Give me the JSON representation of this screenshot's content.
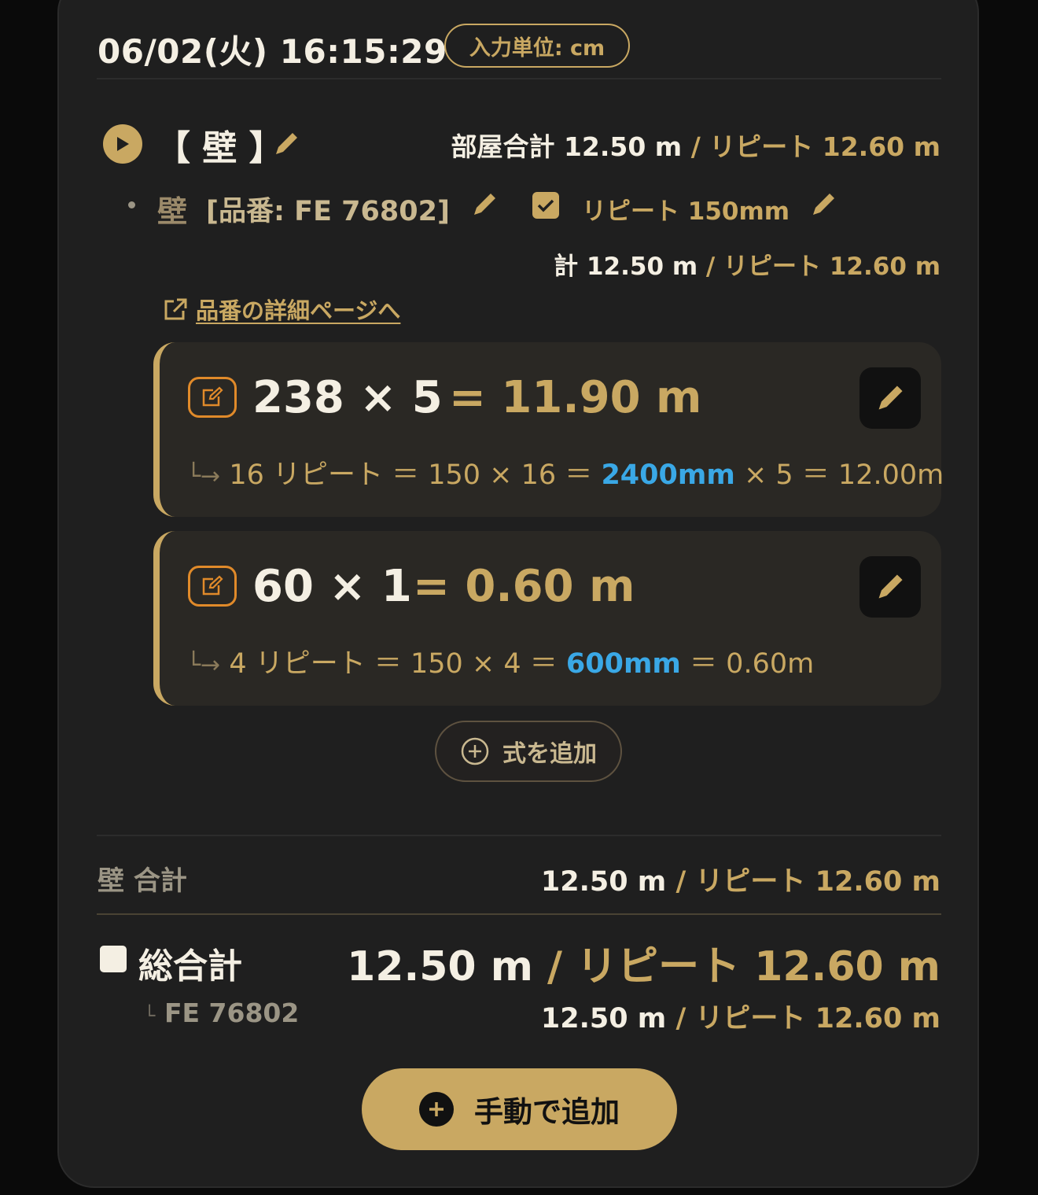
{
  "header": {
    "datetime": "06/02(火) 16:15:29",
    "unit_badge": "入力単位: cm"
  },
  "room": {
    "title": "【 壁 】",
    "total_label": "部屋合計",
    "total_value": "12.50 m",
    "separator": " / ",
    "repeat_label": "リピート",
    "repeat_value": "12.60 m"
  },
  "item": {
    "name": "壁",
    "code": "[品番: FE 76802]",
    "repeat_checked": true,
    "repeat_text": "リピート 150mm",
    "total_label": "計",
    "total_value": "12.50 m",
    "separator": " / ",
    "repeat_label": "リピート",
    "repeat_value": "12.60 m",
    "detail_link": "品番の詳細ページへ"
  },
  "formulas": [
    {
      "expression": "238 × 5",
      "result": "= 11.90 m",
      "detail_prefix": "16 リピート ＝ 150 × 16 ＝",
      "detail_highlight": "2400mm",
      "detail_suffix": "× 5 ＝ 12.00m"
    },
    {
      "expression": "60 × 1",
      "result": "= 0.60 m",
      "detail_prefix": "4 リピート ＝ 150 × 4 ＝",
      "detail_highlight": "600mm",
      "detail_suffix": "＝ 0.60m"
    }
  ],
  "add_formula_label": "式を追加",
  "wall_total": {
    "label": "壁 合計",
    "value": "12.50 m",
    "separator": " / ",
    "repeat_label": "リピート",
    "repeat_value": "12.60 m"
  },
  "grand_total": {
    "label": "総合計",
    "value": "12.50 m",
    "separator": " / ",
    "repeat_label": "リピート",
    "repeat_value": "12.60 m"
  },
  "code_total": {
    "label": "FE 76802",
    "value": "12.50 m",
    "separator": " / ",
    "repeat_label": "リピート",
    "repeat_value": "12.60 m"
  },
  "manual_add_label": "手動で追加",
  "colors": {
    "background": "#0a0a0a",
    "card": "#1f1f1f",
    "gold": "#c9a862",
    "cream": "#f4efe3",
    "blue": "#3aa8e6",
    "orange": "#e08a2a"
  }
}
